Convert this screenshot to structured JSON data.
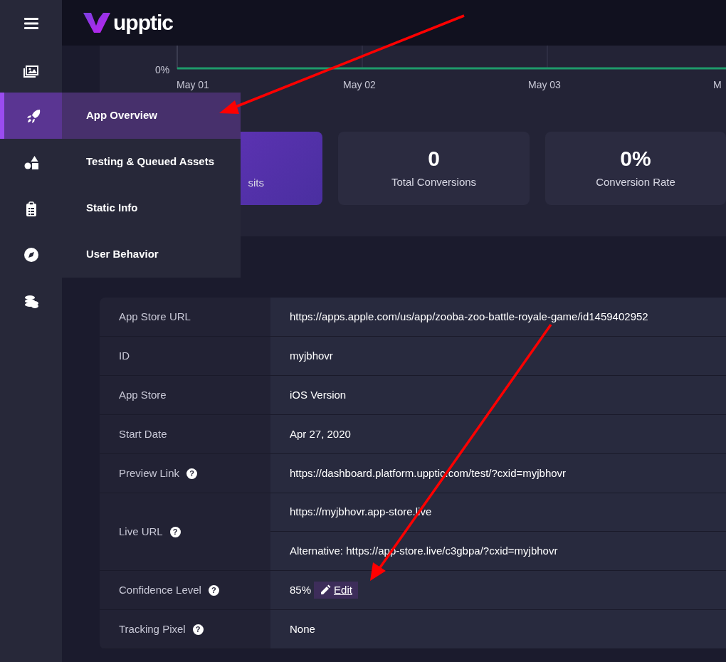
{
  "brand": {
    "name": "upptic"
  },
  "flyout_menu": {
    "items": [
      {
        "label": "App Overview",
        "selected": true
      },
      {
        "label": "Testing & Queued Assets",
        "selected": false
      },
      {
        "label": "Static Info",
        "selected": false
      },
      {
        "label": "User Behavior",
        "selected": false
      }
    ]
  },
  "chart": {
    "y_tick": "0%",
    "x_labels": [
      "May 01",
      "May 02",
      "May 03",
      "M"
    ]
  },
  "stats": [
    {
      "label": "sits",
      "highlighted": true
    },
    {
      "value": "0",
      "label": "Total Conversions",
      "highlighted": false
    },
    {
      "value": "0%",
      "label": "Conversion Rate",
      "highlighted": false
    }
  ],
  "details": {
    "rows": [
      {
        "label": "App Store URL",
        "values": [
          "https://apps.apple.com/us/app/zooba-zoo-battle-royale-game/id1459402952"
        ]
      },
      {
        "label": "ID",
        "values": [
          "myjbhovr"
        ]
      },
      {
        "label": "App Store",
        "values": [
          "iOS Version"
        ]
      },
      {
        "label": "Start Date",
        "values": [
          "Apr 27, 2020"
        ]
      },
      {
        "label": "Preview Link",
        "help": "?",
        "values": [
          "https://dashboard.platform.upptic.com/test/?cxid=myjbhovr"
        ]
      },
      {
        "label": "Live URL",
        "help": "?",
        "values": [
          "https://myjbhovr.app-store.live",
          "Alternative: https://app-store.live/c3gbpa/?cxid=myjbhovr"
        ]
      },
      {
        "label": "Confidence Level",
        "help": "?",
        "values": [
          "85%"
        ],
        "edit": "Edit"
      },
      {
        "label": "Tracking Pixel",
        "help": "?",
        "values": [
          "None"
        ]
      }
    ]
  }
}
